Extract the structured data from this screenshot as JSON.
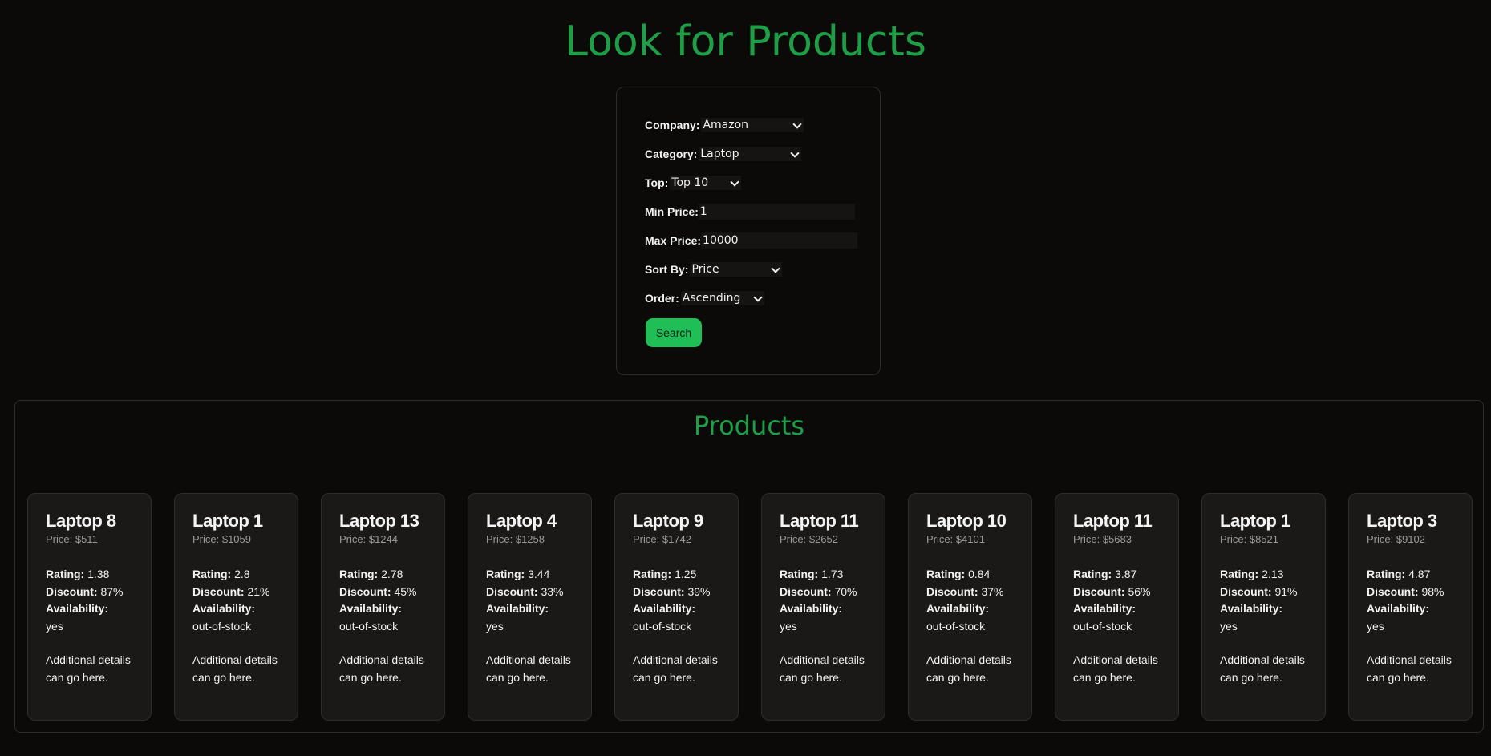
{
  "page_title": "Look for Products",
  "form": {
    "company_label": "Company:",
    "company_value": "Amazon",
    "category_label": "Category:",
    "category_value": "Laptop",
    "top_label": "Top:",
    "top_value": "Top 10",
    "min_price_label": "Min Price:",
    "min_price_value": "1",
    "max_price_label": "Max Price:",
    "max_price_value": "10000",
    "sort_label": "Sort By:",
    "sort_value": "Price",
    "order_label": "Order:",
    "order_value": "Ascending",
    "search_label": "Search"
  },
  "products": {
    "title": "Products",
    "field_labels": {
      "rating": "Rating:",
      "discount": "Discount:",
      "availability": "Availability:"
    },
    "details_text": "Additional details can go here.",
    "items": [
      {
        "name": "Laptop 8",
        "price": "Price: $511",
        "rating": "1.38",
        "discount": "87%",
        "availability": "yes"
      },
      {
        "name": "Laptop 1",
        "price": "Price: $1059",
        "rating": "2.8",
        "discount": "21%",
        "availability": "out-of-stock"
      },
      {
        "name": "Laptop 13",
        "price": "Price: $1244",
        "rating": "2.78",
        "discount": "45%",
        "availability": "out-of-stock"
      },
      {
        "name": "Laptop 4",
        "price": "Price: $1258",
        "rating": "3.44",
        "discount": "33%",
        "availability": "yes"
      },
      {
        "name": "Laptop 9",
        "price": "Price: $1742",
        "rating": "1.25",
        "discount": "39%",
        "availability": "out-of-stock"
      },
      {
        "name": "Laptop 11",
        "price": "Price: $2652",
        "rating": "1.73",
        "discount": "70%",
        "availability": "yes"
      },
      {
        "name": "Laptop 10",
        "price": "Price: $4101",
        "rating": "0.84",
        "discount": "37%",
        "availability": "out-of-stock"
      },
      {
        "name": "Laptop 11",
        "price": "Price: $5683",
        "rating": "3.87",
        "discount": "56%",
        "availability": "out-of-stock"
      },
      {
        "name": "Laptop 1",
        "price": "Price: $8521",
        "rating": "2.13",
        "discount": "91%",
        "availability": "yes"
      },
      {
        "name": "Laptop 3",
        "price": "Price: $9102",
        "rating": "4.87",
        "discount": "98%",
        "availability": "yes"
      }
    ]
  },
  "colors": {
    "background": "#0b0a09",
    "accent_green": "#1e9e47",
    "button_green": "#1fbe56",
    "card_background": "#1b1917"
  }
}
